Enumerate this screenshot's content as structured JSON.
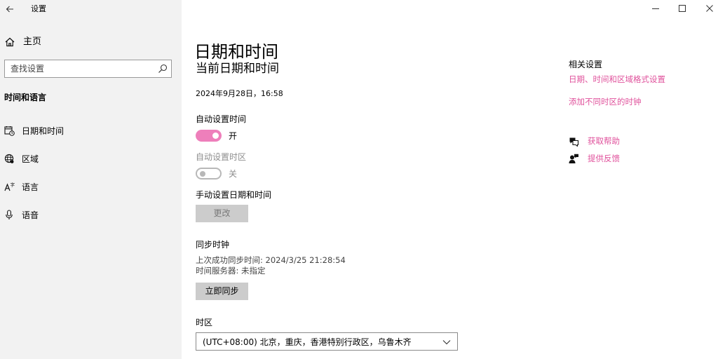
{
  "window": {
    "app_title": "设置",
    "controls": {
      "minimize": "minimize",
      "maximize": "maximize",
      "close": "close"
    }
  },
  "sidebar": {
    "home_label": "主页",
    "search_placeholder": "查找设置",
    "section_title": "时间和语言",
    "items": [
      {
        "label": "日期和时间",
        "icon": "calendar-clock-icon",
        "selected": true
      },
      {
        "label": "区域",
        "icon": "globe-icon"
      },
      {
        "label": "语言",
        "icon": "language-icon"
      },
      {
        "label": "语音",
        "icon": "microphone-icon"
      }
    ]
  },
  "main": {
    "page_title": "日期和时间",
    "subtitle": "当前日期和时间",
    "current_datetime": "2024年9月28日，16:58",
    "auto_time": {
      "label": "自动设置时间",
      "state": "开",
      "on": true
    },
    "auto_timezone": {
      "label": "自动设置时区",
      "state": "关",
      "on": false,
      "disabled": true
    },
    "manual": {
      "label": "手动设置日期和时间",
      "button": "更改",
      "disabled": true
    },
    "sync": {
      "label": "同步时钟",
      "last_sync": "上次成功同步时间: 2024/3/25 21:28:54",
      "server": "时间服务器: 未指定",
      "button": "立即同步"
    },
    "timezone": {
      "label": "时区",
      "value": "(UTC+08:00) 北京，重庆，香港特别行政区，乌鲁木齐"
    }
  },
  "related": {
    "title": "相关设置",
    "links": [
      "日期、时间和区域格式设置",
      "添加不同时区的时钟"
    ],
    "get_help": "获取帮助",
    "feedback": "提供反馈"
  },
  "colors": {
    "accent": "#ee7fbb",
    "link": "#e0529c",
    "sidebar_bg": "#f2f2f2",
    "button_bg": "#cccccc"
  }
}
